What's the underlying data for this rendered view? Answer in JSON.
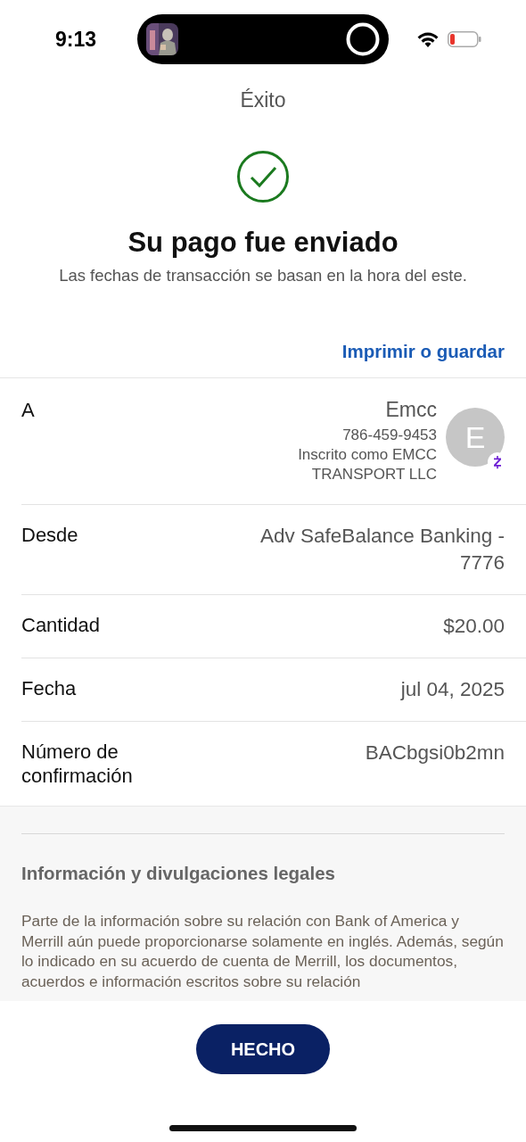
{
  "status_bar": {
    "time": "9:13"
  },
  "nav": {
    "title": "Éxito"
  },
  "confirmation": {
    "heading": "Su pago fue enviado",
    "subtitle": "Las fechas de transacción se basan en la hora del este."
  },
  "print_link": "Imprimir o guardar",
  "details": [
    {
      "kind": "recipient",
      "label": "A",
      "name": "Emcc",
      "phone": "786-459-9453",
      "enrolled": "Inscrito como EMCC TRANSPORT LLC",
      "avatar_initial": "E"
    },
    {
      "kind": "plain",
      "label": "Desde",
      "value": "Adv SafeBalance Banking - 7776"
    },
    {
      "kind": "plain",
      "label": "Cantidad",
      "value": "$20.00"
    },
    {
      "kind": "plain",
      "label": "Fecha",
      "value": "jul 04, 2025"
    },
    {
      "kind": "plain",
      "label": "Número de confirmación",
      "value": "BACbgsi0b2mn"
    }
  ],
  "legal": {
    "heading": "Información y divulgaciones legales",
    "text": "Parte de la información sobre su relación con Bank of America y Merrill aún puede proporcionarse solamente en inglés. Además, según lo indicado en su acuerdo de cuenta de Merrill, los documentos, acuerdos e información escritos sobre su relación"
  },
  "done_button": "HECHO"
}
